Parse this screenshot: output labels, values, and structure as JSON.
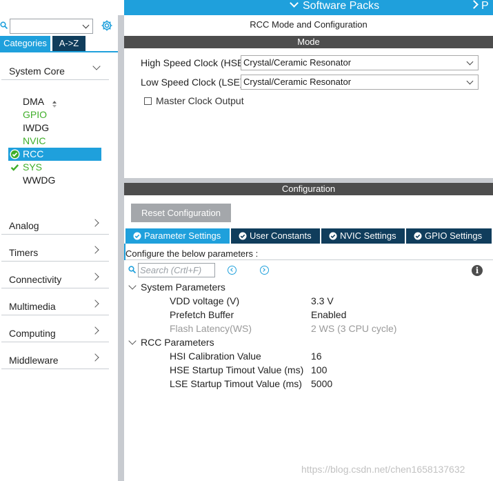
{
  "topbar": {
    "software_packs": "Software Packs",
    "next_menu": "P"
  },
  "sidebar": {
    "search": {
      "value": "",
      "placeholder": ""
    },
    "tabs": {
      "categories": "Categories",
      "az": "A->Z"
    },
    "system_core": {
      "label": "System Core"
    },
    "peripherals": [
      {
        "label": "DMA",
        "state": "normal"
      },
      {
        "label": "GPIO",
        "state": "green"
      },
      {
        "label": "IWDG",
        "state": "normal"
      },
      {
        "label": "NVIC",
        "state": "green"
      },
      {
        "label": "RCC",
        "state": "selected"
      },
      {
        "label": "SYS",
        "state": "green-check"
      },
      {
        "label": "WWDG",
        "state": "normal"
      }
    ],
    "categories": [
      "Analog",
      "Timers",
      "Connectivity",
      "Multimedia",
      "Computing",
      "Middleware"
    ]
  },
  "main": {
    "title": "RCC Mode and Configuration",
    "mode_bar": "Mode",
    "hse": {
      "label": "High Speed Clock (HSE)",
      "value": "Crystal/Ceramic Resonator"
    },
    "lse": {
      "label": "Low Speed Clock (LSE)",
      "value": "Crystal/Ceramic Resonator"
    },
    "mco": {
      "label": "Master Clock Output",
      "checked": false
    },
    "config_bar": "Configuration",
    "reset_button": "Reset Configuration",
    "tabs": [
      {
        "label": "Parameter Settings",
        "active": true
      },
      {
        "label": "User Constants",
        "active": false
      },
      {
        "label": "NVIC Settings",
        "active": false
      },
      {
        "label": "GPIO Settings",
        "active": false
      }
    ],
    "configure_text": "Configure the below parameters :",
    "param_search_placeholder": "Search (Crtl+F)",
    "info_glyph": "i",
    "groups": [
      {
        "name": "System Parameters",
        "params": [
          {
            "name": "VDD voltage (V)",
            "value": "3.3 V",
            "muted": false
          },
          {
            "name": "Prefetch Buffer",
            "value": "Enabled",
            "muted": false
          },
          {
            "name": "Flash Latency(WS)",
            "value": "2 WS (3 CPU cycle)",
            "muted": true
          }
        ]
      },
      {
        "name": "RCC Parameters",
        "params": [
          {
            "name": "HSI Calibration Value",
            "value": "16",
            "muted": false
          },
          {
            "name": "HSE Startup Timout Value (ms)",
            "value": "100",
            "muted": false
          },
          {
            "name": "LSE Startup Timout Value (ms)",
            "value": "5000",
            "muted": false
          }
        ]
      }
    ]
  },
  "watermark": "https://blog.csdn.net/chen1658137632",
  "colors": {
    "accent": "#1fa0dc",
    "dark_tab": "#103d5c",
    "bar": "#4d4d4d",
    "green": "#3fae29"
  }
}
